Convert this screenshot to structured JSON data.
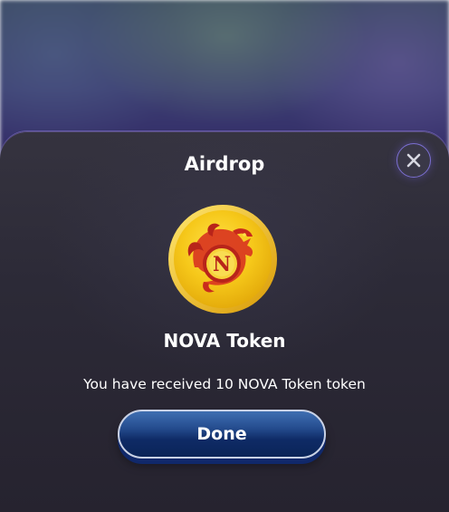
{
  "modal": {
    "title": "Airdrop",
    "close_icon": "close-icon",
    "token": {
      "icon": "dragon-coin-icon",
      "emblem_letter": "N",
      "name": "NOVA Token"
    },
    "message": "You have received 10 NOVA Token token",
    "done_label": "Done"
  },
  "colors": {
    "accent_border": "#7b6fd0",
    "coin_gold": "#f2c21b",
    "coin_dragon": "#d8321e",
    "button_blue_top": "#3f6fb2",
    "button_blue_bottom": "#0a2458"
  }
}
